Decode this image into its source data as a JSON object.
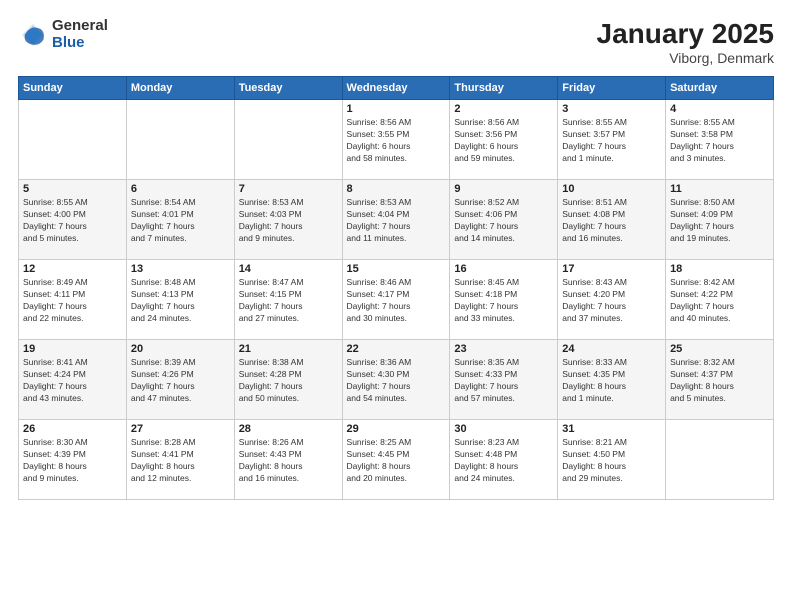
{
  "header": {
    "logo_general": "General",
    "logo_blue": "Blue",
    "title": "January 2025",
    "subtitle": "Viborg, Denmark"
  },
  "weekdays": [
    "Sunday",
    "Monday",
    "Tuesday",
    "Wednesday",
    "Thursday",
    "Friday",
    "Saturday"
  ],
  "weeks": [
    [
      {
        "day": "",
        "info": ""
      },
      {
        "day": "",
        "info": ""
      },
      {
        "day": "",
        "info": ""
      },
      {
        "day": "1",
        "info": "Sunrise: 8:56 AM\nSunset: 3:55 PM\nDaylight: 6 hours\nand 58 minutes."
      },
      {
        "day": "2",
        "info": "Sunrise: 8:56 AM\nSunset: 3:56 PM\nDaylight: 6 hours\nand 59 minutes."
      },
      {
        "day": "3",
        "info": "Sunrise: 8:55 AM\nSunset: 3:57 PM\nDaylight: 7 hours\nand 1 minute."
      },
      {
        "day": "4",
        "info": "Sunrise: 8:55 AM\nSunset: 3:58 PM\nDaylight: 7 hours\nand 3 minutes."
      }
    ],
    [
      {
        "day": "5",
        "info": "Sunrise: 8:55 AM\nSunset: 4:00 PM\nDaylight: 7 hours\nand 5 minutes."
      },
      {
        "day": "6",
        "info": "Sunrise: 8:54 AM\nSunset: 4:01 PM\nDaylight: 7 hours\nand 7 minutes."
      },
      {
        "day": "7",
        "info": "Sunrise: 8:53 AM\nSunset: 4:03 PM\nDaylight: 7 hours\nand 9 minutes."
      },
      {
        "day": "8",
        "info": "Sunrise: 8:53 AM\nSunset: 4:04 PM\nDaylight: 7 hours\nand 11 minutes."
      },
      {
        "day": "9",
        "info": "Sunrise: 8:52 AM\nSunset: 4:06 PM\nDaylight: 7 hours\nand 14 minutes."
      },
      {
        "day": "10",
        "info": "Sunrise: 8:51 AM\nSunset: 4:08 PM\nDaylight: 7 hours\nand 16 minutes."
      },
      {
        "day": "11",
        "info": "Sunrise: 8:50 AM\nSunset: 4:09 PM\nDaylight: 7 hours\nand 19 minutes."
      }
    ],
    [
      {
        "day": "12",
        "info": "Sunrise: 8:49 AM\nSunset: 4:11 PM\nDaylight: 7 hours\nand 22 minutes."
      },
      {
        "day": "13",
        "info": "Sunrise: 8:48 AM\nSunset: 4:13 PM\nDaylight: 7 hours\nand 24 minutes."
      },
      {
        "day": "14",
        "info": "Sunrise: 8:47 AM\nSunset: 4:15 PM\nDaylight: 7 hours\nand 27 minutes."
      },
      {
        "day": "15",
        "info": "Sunrise: 8:46 AM\nSunset: 4:17 PM\nDaylight: 7 hours\nand 30 minutes."
      },
      {
        "day": "16",
        "info": "Sunrise: 8:45 AM\nSunset: 4:18 PM\nDaylight: 7 hours\nand 33 minutes."
      },
      {
        "day": "17",
        "info": "Sunrise: 8:43 AM\nSunset: 4:20 PM\nDaylight: 7 hours\nand 37 minutes."
      },
      {
        "day": "18",
        "info": "Sunrise: 8:42 AM\nSunset: 4:22 PM\nDaylight: 7 hours\nand 40 minutes."
      }
    ],
    [
      {
        "day": "19",
        "info": "Sunrise: 8:41 AM\nSunset: 4:24 PM\nDaylight: 7 hours\nand 43 minutes."
      },
      {
        "day": "20",
        "info": "Sunrise: 8:39 AM\nSunset: 4:26 PM\nDaylight: 7 hours\nand 47 minutes."
      },
      {
        "day": "21",
        "info": "Sunrise: 8:38 AM\nSunset: 4:28 PM\nDaylight: 7 hours\nand 50 minutes."
      },
      {
        "day": "22",
        "info": "Sunrise: 8:36 AM\nSunset: 4:30 PM\nDaylight: 7 hours\nand 54 minutes."
      },
      {
        "day": "23",
        "info": "Sunrise: 8:35 AM\nSunset: 4:33 PM\nDaylight: 7 hours\nand 57 minutes."
      },
      {
        "day": "24",
        "info": "Sunrise: 8:33 AM\nSunset: 4:35 PM\nDaylight: 8 hours\nand 1 minute."
      },
      {
        "day": "25",
        "info": "Sunrise: 8:32 AM\nSunset: 4:37 PM\nDaylight: 8 hours\nand 5 minutes."
      }
    ],
    [
      {
        "day": "26",
        "info": "Sunrise: 8:30 AM\nSunset: 4:39 PM\nDaylight: 8 hours\nand 9 minutes."
      },
      {
        "day": "27",
        "info": "Sunrise: 8:28 AM\nSunset: 4:41 PM\nDaylight: 8 hours\nand 12 minutes."
      },
      {
        "day": "28",
        "info": "Sunrise: 8:26 AM\nSunset: 4:43 PM\nDaylight: 8 hours\nand 16 minutes."
      },
      {
        "day": "29",
        "info": "Sunrise: 8:25 AM\nSunset: 4:45 PM\nDaylight: 8 hours\nand 20 minutes."
      },
      {
        "day": "30",
        "info": "Sunrise: 8:23 AM\nSunset: 4:48 PM\nDaylight: 8 hours\nand 24 minutes."
      },
      {
        "day": "31",
        "info": "Sunrise: 8:21 AM\nSunset: 4:50 PM\nDaylight: 8 hours\nand 29 minutes."
      },
      {
        "day": "",
        "info": ""
      }
    ]
  ]
}
